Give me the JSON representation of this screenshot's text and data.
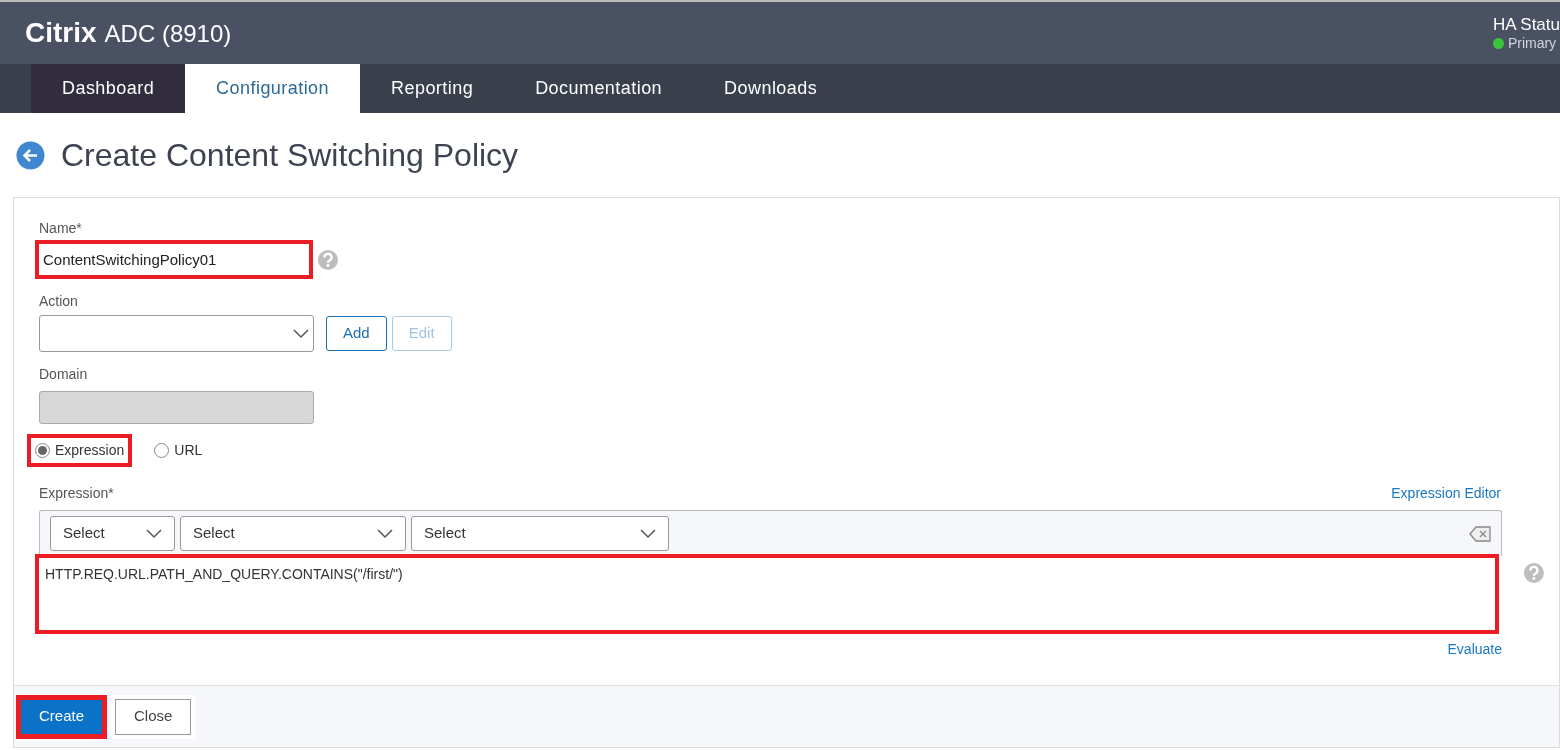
{
  "header": {
    "brand": "Citrix",
    "product": "ADC (8910)",
    "ha_status": {
      "label": "HA Statu",
      "state": "Primary",
      "color": "#3cc43c"
    }
  },
  "tabs": [
    {
      "label": "Dashboard",
      "selected": false,
      "hovered": true
    },
    {
      "label": "Configuration",
      "selected": true,
      "hovered": false
    },
    {
      "label": "Reporting",
      "selected": false,
      "hovered": false
    },
    {
      "label": "Documentation",
      "selected": false,
      "hovered": false
    },
    {
      "label": "Downloads",
      "selected": false,
      "hovered": false
    }
  ],
  "page_title": "Create Content Switching Policy",
  "form": {
    "name": {
      "label": "Name*",
      "value": "ContentSwitchingPolicy01",
      "highlighted": true
    },
    "action": {
      "label": "Action",
      "add_button": "Add",
      "edit_button": "Edit",
      "edit_disabled": true
    },
    "domain": {
      "label": "Domain",
      "disabled": true
    },
    "mode": [
      {
        "label": "Expression",
        "selected": true,
        "highlighted": true
      },
      {
        "label": "URL",
        "selected": false,
        "highlighted": false
      }
    ],
    "expression": {
      "label": "Expression*",
      "editor_link": "Expression Editor",
      "selects": [
        "Select",
        "Select",
        "Select"
      ],
      "value": "HTTP.REQ.URL.PATH_AND_QUERY.CONTAINS(\"/first/\")",
      "highlighted": true,
      "evaluate_link": "Evaluate"
    }
  },
  "footer": {
    "buttons": [
      {
        "label": "Create",
        "kind": "primary",
        "highlighted": true
      },
      {
        "label": "Close",
        "kind": "secondary",
        "highlighted": false
      }
    ]
  }
}
